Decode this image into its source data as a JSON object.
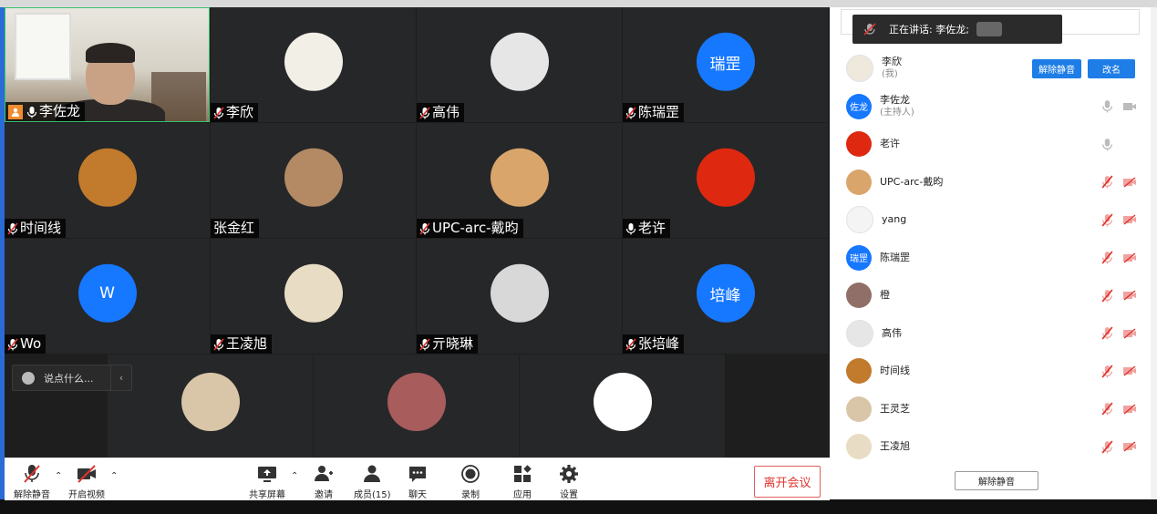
{
  "speaking_banner": {
    "label": "正在讲话: 李佐龙;"
  },
  "tiles": [
    {
      "name": "李佐龙",
      "mic": "on",
      "host": true
    },
    {
      "name": "李欣",
      "mic": "off",
      "avatar_color": "#f2efe6"
    },
    {
      "name": "高伟",
      "mic": "off",
      "avatar_color": "#e6e6e6"
    },
    {
      "name": "陈瑞罡",
      "mic": "off",
      "avatar_text": "瑞罡",
      "avatar_color": "#1677ff"
    },
    {
      "name": "时间线",
      "mic": "off",
      "avatar_color": "#c27a2c"
    },
    {
      "name": "张金红",
      "mic": "none",
      "avatar_color": "#b38a64"
    },
    {
      "name": "UPC-arc-戴昀",
      "mic": "off",
      "avatar_color": "#d9a56a"
    },
    {
      "name": "老许",
      "mic": "on",
      "avatar_color": "#de2910"
    },
    {
      "name": "Wo",
      "mic": "off",
      "avatar_text": "W",
      "avatar_color": "#1677ff"
    },
    {
      "name": "王凌旭",
      "mic": "off",
      "avatar_color": "#e8dcc4"
    },
    {
      "name": "亓晓琳",
      "mic": "off",
      "avatar_color": "#d8d8d8"
    },
    {
      "name": "张培峰",
      "mic": "off",
      "avatar_text": "培峰",
      "avatar_color": "#1677ff"
    }
  ],
  "tiles_row4": [
    {
      "avatar_color": "#d9c6a8"
    },
    {
      "avatar_color": "#a85c5c"
    },
    {
      "avatar_color": "#ffffff"
    }
  ],
  "chat": {
    "placeholder": "说点什么..."
  },
  "toolbar": {
    "mute": "解除静音",
    "video": "开启视频",
    "share": "共享屏幕",
    "invite": "邀请",
    "members": "成员(15)",
    "chat": "聊天",
    "record": "录制",
    "apps": "应用",
    "settings": "设置",
    "leave": "离开会议"
  },
  "participants": [
    {
      "name": "李欣",
      "sub": "(我)",
      "avatar_color": "#efe8dd",
      "actions": [
        "解除静音",
        "改名"
      ]
    },
    {
      "name": "李佐龙",
      "sub": "(主持人)",
      "avatar_text": "佐龙",
      "avatar_color": "#1677ff",
      "mic": "on",
      "cam": "on"
    },
    {
      "name": "老许",
      "avatar_color": "#de2910",
      "mic": "on"
    },
    {
      "name": "UPC-arc-戴昀",
      "avatar_color": "#d9a56a",
      "mic": "off",
      "cam": "off"
    },
    {
      "name": "yang",
      "avatar_color": "#f4f4f4",
      "mic": "off",
      "cam": "off"
    },
    {
      "name": "陈瑞罡",
      "avatar_text": "瑞罡",
      "avatar_color": "#1677ff",
      "mic": "off",
      "cam": "off"
    },
    {
      "name": "橙",
      "avatar_color": "#8f6f67",
      "mic": "off",
      "cam": "off"
    },
    {
      "name": "高伟",
      "avatar_color": "#e6e6e6",
      "mic": "off",
      "cam": "off"
    },
    {
      "name": "时间线",
      "avatar_color": "#c27a2c",
      "mic": "off",
      "cam": "off"
    },
    {
      "name": "王灵芝",
      "avatar_color": "#d9c6a8",
      "mic": "off",
      "cam": "off"
    },
    {
      "name": "王凌旭",
      "avatar_color": "#e8dcc4",
      "mic": "off",
      "cam": "off"
    }
  ],
  "panel": {
    "unmute_all": "解除静音"
  }
}
